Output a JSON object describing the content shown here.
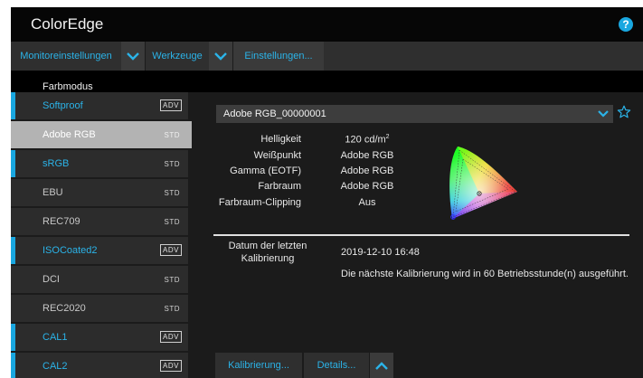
{
  "app": {
    "title": "ColorEdge",
    "help_glyph": "?"
  },
  "menu": {
    "monitor_settings": "Monitoreinstellungen",
    "tools": "Werkzeuge",
    "settings": "Einstellungen..."
  },
  "sidebar": {
    "title": "Farbmodus",
    "items": [
      {
        "label": "Softproof",
        "tag": "ADV"
      },
      {
        "label": "Adobe RGB",
        "tag": "STD"
      },
      {
        "label": "sRGB",
        "tag": "STD"
      },
      {
        "label": "EBU",
        "tag": "STD"
      },
      {
        "label": "REC709",
        "tag": "STD"
      },
      {
        "label": "ISOCoated2",
        "tag": "ADV"
      },
      {
        "label": "DCI",
        "tag": "STD"
      },
      {
        "label": "REC2020",
        "tag": "STD"
      },
      {
        "label": "CAL1",
        "tag": "ADV"
      },
      {
        "label": "CAL2",
        "tag": "ADV"
      }
    ],
    "selected": "Adobe RGB"
  },
  "detail": {
    "mode_select": "Adobe RGB_00000001",
    "properties": {
      "brightness_label": "Helligkeit",
      "brightness_value": "120 cd/m",
      "brightness_unit_sup": "2",
      "white_point_label": "Weißpunkt",
      "white_point_value": "Adobe RGB",
      "gamma_label": "Gamma (EOTF)",
      "gamma_value": "Adobe RGB",
      "color_space_label": "Farbraum",
      "color_space_value": "Adobe RGB",
      "clipping_label": "Farbraum-Clipping",
      "clipping_value": "Aus"
    },
    "calibration": {
      "last_label_line1": "Datum der letzten",
      "last_label_line2": "Kalibrierung",
      "last_date": "2019-12-10 16:48",
      "next_message": "Die nächste Kalibrierung wird in 60 Betriebsstunde(n) ausgeführt."
    }
  },
  "buttons": {
    "calibrate": "Kalibrierung...",
    "details": "Details..."
  },
  "colors": {
    "accent": "#19a7e0",
    "accent_text": "#2bb3e8",
    "background": "#1b1b1b",
    "selected_item": "#b3b3b3"
  },
  "icons": [
    "help-icon",
    "chevron-down-icon",
    "star-icon",
    "chevron-up-icon",
    "gamut-diagram"
  ]
}
